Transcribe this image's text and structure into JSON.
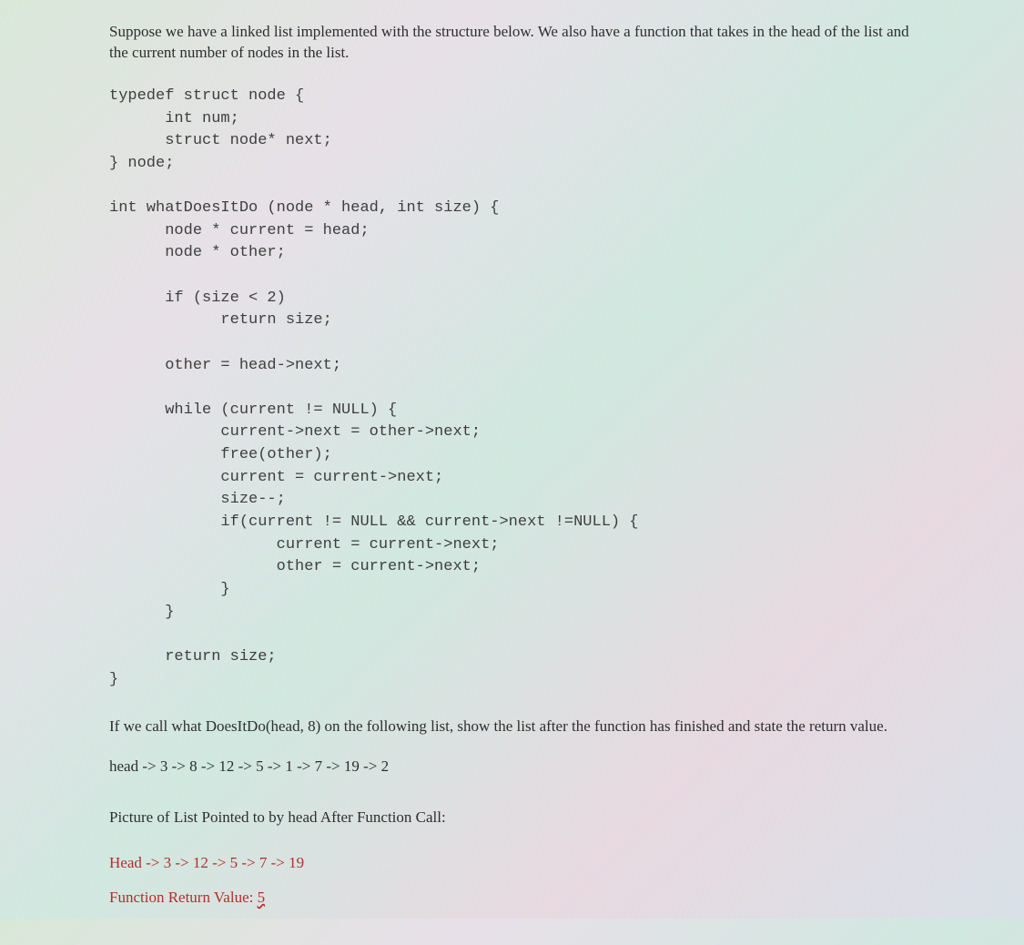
{
  "intro": "Suppose we have a linked list implemented with the structure below. We also have a function that takes in the head of the list and the current number of nodes in the list.",
  "code": "typedef struct node {\n      int num;\n      struct node* next;\n} node;\n\nint whatDoesItDo (node * head, int size) {\n      node * current = head;\n      node * other;\n\n      if (size < 2)\n            return size;\n\n      other = head->next;\n\n      while (current != NULL) {\n            current->next = other->next;\n            free(other);\n            current = current->next;\n            size--;\n            if(current != NULL && current->next !=NULL) {\n                  current = current->next;\n                  other = current->next;\n            }\n      }\n\n      return size;\n}",
  "question": "If we call what DoesItDo(head, 8) on the following list, show the list after the function has finished and state the return value.",
  "listdesc": "head -> 3 -> 8 -> 12 -> 5 -> 1 -> 7 -> 19 -> 2",
  "prompt": "Picture of List Pointed to by head After Function Call:",
  "answer_list": "Head -> 3 -> 12 -> 5 -> 7 -> 19",
  "answer_return_label": "Function Return Value: ",
  "answer_return_value": "5"
}
